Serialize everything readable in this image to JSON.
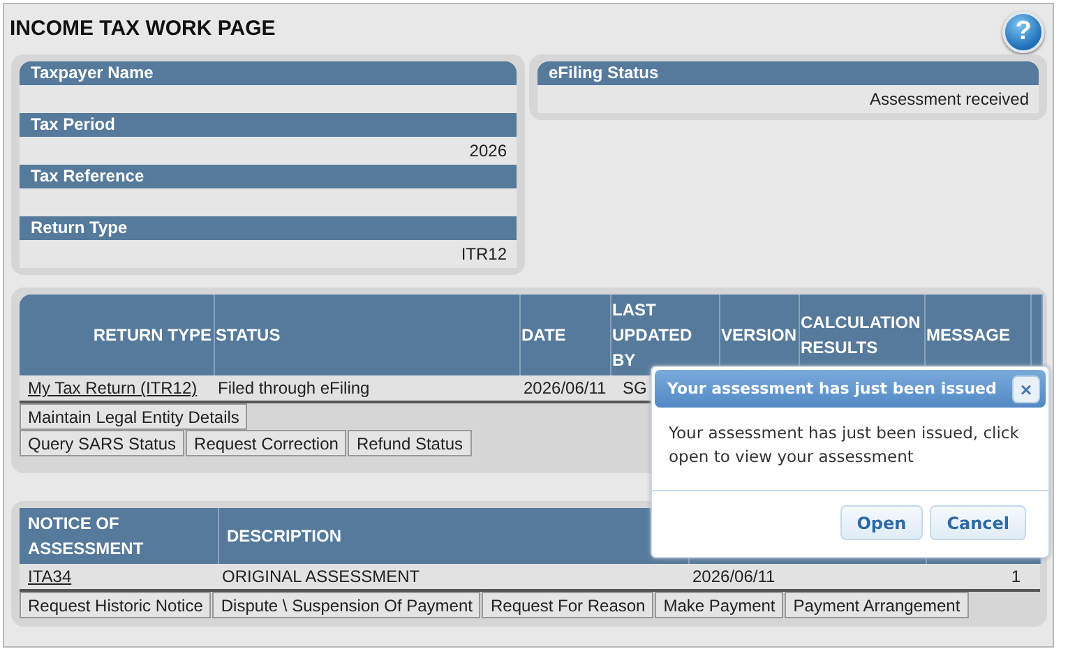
{
  "page": {
    "title": "INCOME TAX WORK PAGE",
    "help_icon": "?"
  },
  "details": [
    {
      "label": "Taxpayer Name"
    },
    {
      "label": "Tax Period",
      "value": "2026"
    },
    {
      "label": "Tax Reference"
    },
    {
      "label": "Return Type",
      "value": "ITR12"
    }
  ],
  "efiling": {
    "label": "eFiling Status",
    "value": "Assessment received"
  },
  "returns": {
    "columns": [
      "RETURN TYPE",
      "STATUS",
      "DATE",
      "LAST UPDATED BY",
      "VERSION",
      "CALCULATION RESULTS",
      "MESSAGE"
    ],
    "rows": [
      {
        "return_type": "My Tax Return (ITR12)",
        "status": "Filed through eFiling",
        "date": "2026/06/11",
        "last_updated_by": "SG"
      }
    ],
    "button_rows": [
      [
        "Maintain Legal Entity Details"
      ],
      [
        "Query SARS Status",
        "Request Correction",
        "Refund Status"
      ]
    ]
  },
  "notices": {
    "columns": [
      "NOTICE OF ASSESSMENT",
      "DESCRIPTION"
    ],
    "rows": [
      {
        "notice": "ITA34",
        "description": "ORIGINAL ASSESSMENT",
        "date": "2026/06/11",
        "column_4": "1"
      }
    ],
    "buttons": [
      "Request Historic Notice",
      "Dispute \\ Suspension Of Payment",
      "Request For Reason",
      "Make Payment",
      "Payment Arrangement"
    ]
  },
  "dialog": {
    "title": "Your assessment has just been issued",
    "close": "×",
    "message": "Your assessment has just been issued, click open to view your assessment",
    "buttons": [
      "Open",
      "Cancel"
    ]
  }
}
